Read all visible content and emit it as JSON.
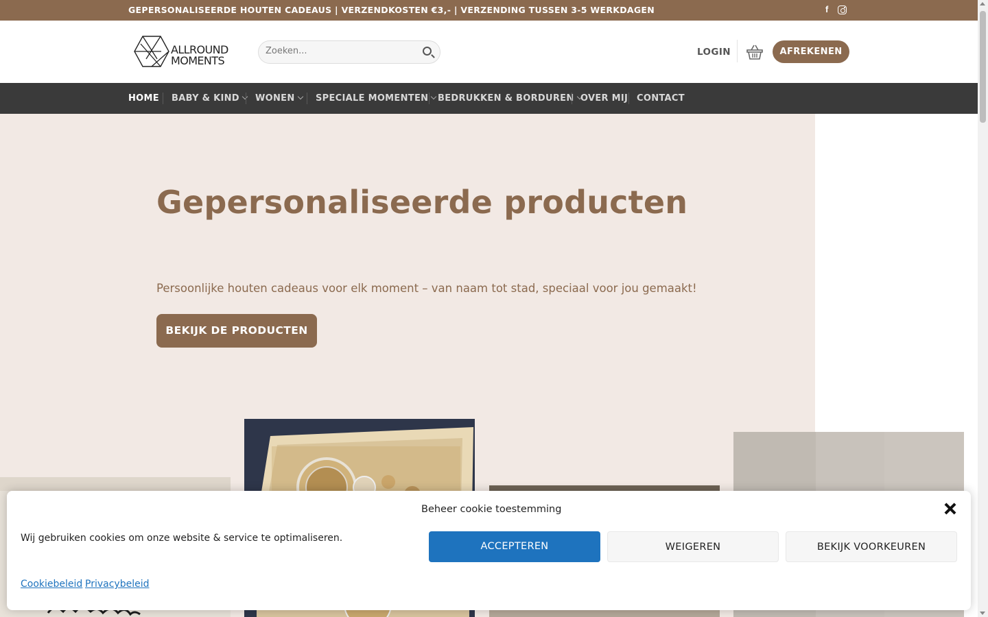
{
  "theme": {
    "brand": "#8b6a4f",
    "nav_bg": "#3a3a3a",
    "hero_bg": "#f2e9e4",
    "accept": "#1e73be"
  },
  "topbar": {
    "message": "GEPERSONALISEERDE HOUTEN CADEAUS | VERZENDKOSTEN €3,- | VERZENDING TUSSEN 3-5 WERKDAGEN",
    "social": [
      "facebook-icon",
      "instagram-icon"
    ],
    "facebook_glyph": "f"
  },
  "header": {
    "logo_line1": "ALLROUND",
    "logo_line2": "MOMENTS",
    "search_placeholder": "Zoeken...",
    "login_label": "LOGIN",
    "checkout_label": "AFREKENEN"
  },
  "nav": {
    "items": [
      {
        "label": "HOME",
        "has_dropdown": false,
        "active": true
      },
      {
        "label": "BABY & KIND",
        "has_dropdown": true
      },
      {
        "label": "WONEN",
        "has_dropdown": true
      },
      {
        "label": "SPECIALE MOMENTEN",
        "has_dropdown": true
      },
      {
        "label": "BEDRUKKEN & BORDUREN",
        "has_dropdown": true
      },
      {
        "label": "OVER MIJ",
        "has_dropdown": false
      },
      {
        "label": "CONTACT",
        "has_dropdown": false
      }
    ]
  },
  "hero": {
    "title": "Gepersonaliseerde producten",
    "subtitle": "Persoonlijke houten cadeaus voor elk moment – van naam tot stad, speciaal voor jou gemaakt!",
    "button_label": "BEKIJK DE PRODUCTEN"
  },
  "cookie": {
    "title": "Beheer cookie toestemming",
    "message": "Wij gebruiken cookies om onze website & service te optimaliseren.",
    "accept_label": "ACCEPTEREN",
    "deny_label": "WEIGEREN",
    "prefs_label": "BEKIJK VOORKEUREN",
    "links": [
      "Cookiebeleid",
      "Privacybeleid"
    ]
  }
}
